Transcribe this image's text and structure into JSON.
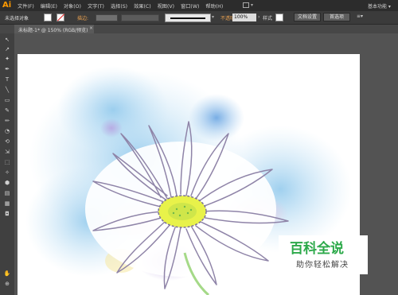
{
  "app": {
    "logo": "Ai",
    "workspace_label": "基本功能 ▾"
  },
  "menu": [
    "文件(F)",
    "编辑(E)",
    "对象(O)",
    "文字(T)",
    "选择(S)",
    "效果(C)",
    "视图(V)",
    "窗口(W)",
    "帮助(H)"
  ],
  "control_bar": {
    "selection_status": "未选择对象",
    "stroke_label": "描边:",
    "opacity_label": "不透明度",
    "opacity_value": "100%",
    "style_label": "样式",
    "doc_setup_button": "文档设置",
    "preferences_button": "首选项"
  },
  "tab": {
    "title": "未标题-1* @ 150% (RGB/预览)",
    "close": "×"
  },
  "tools": [
    "↖",
    "↗",
    "✦",
    "✒",
    "T",
    "╲",
    "▭",
    "✎",
    "✏",
    "◔",
    "⟲",
    "⇲",
    "⬚",
    "✧",
    "⬢",
    "▤",
    "▦",
    "◘",
    "✋",
    "⊕"
  ],
  "watermark": {
    "line1": "百科全说",
    "line2": "助你轻松解决"
  },
  "colors": {
    "accent": "#ff9a00",
    "watermark_green": "#2ca94a"
  }
}
